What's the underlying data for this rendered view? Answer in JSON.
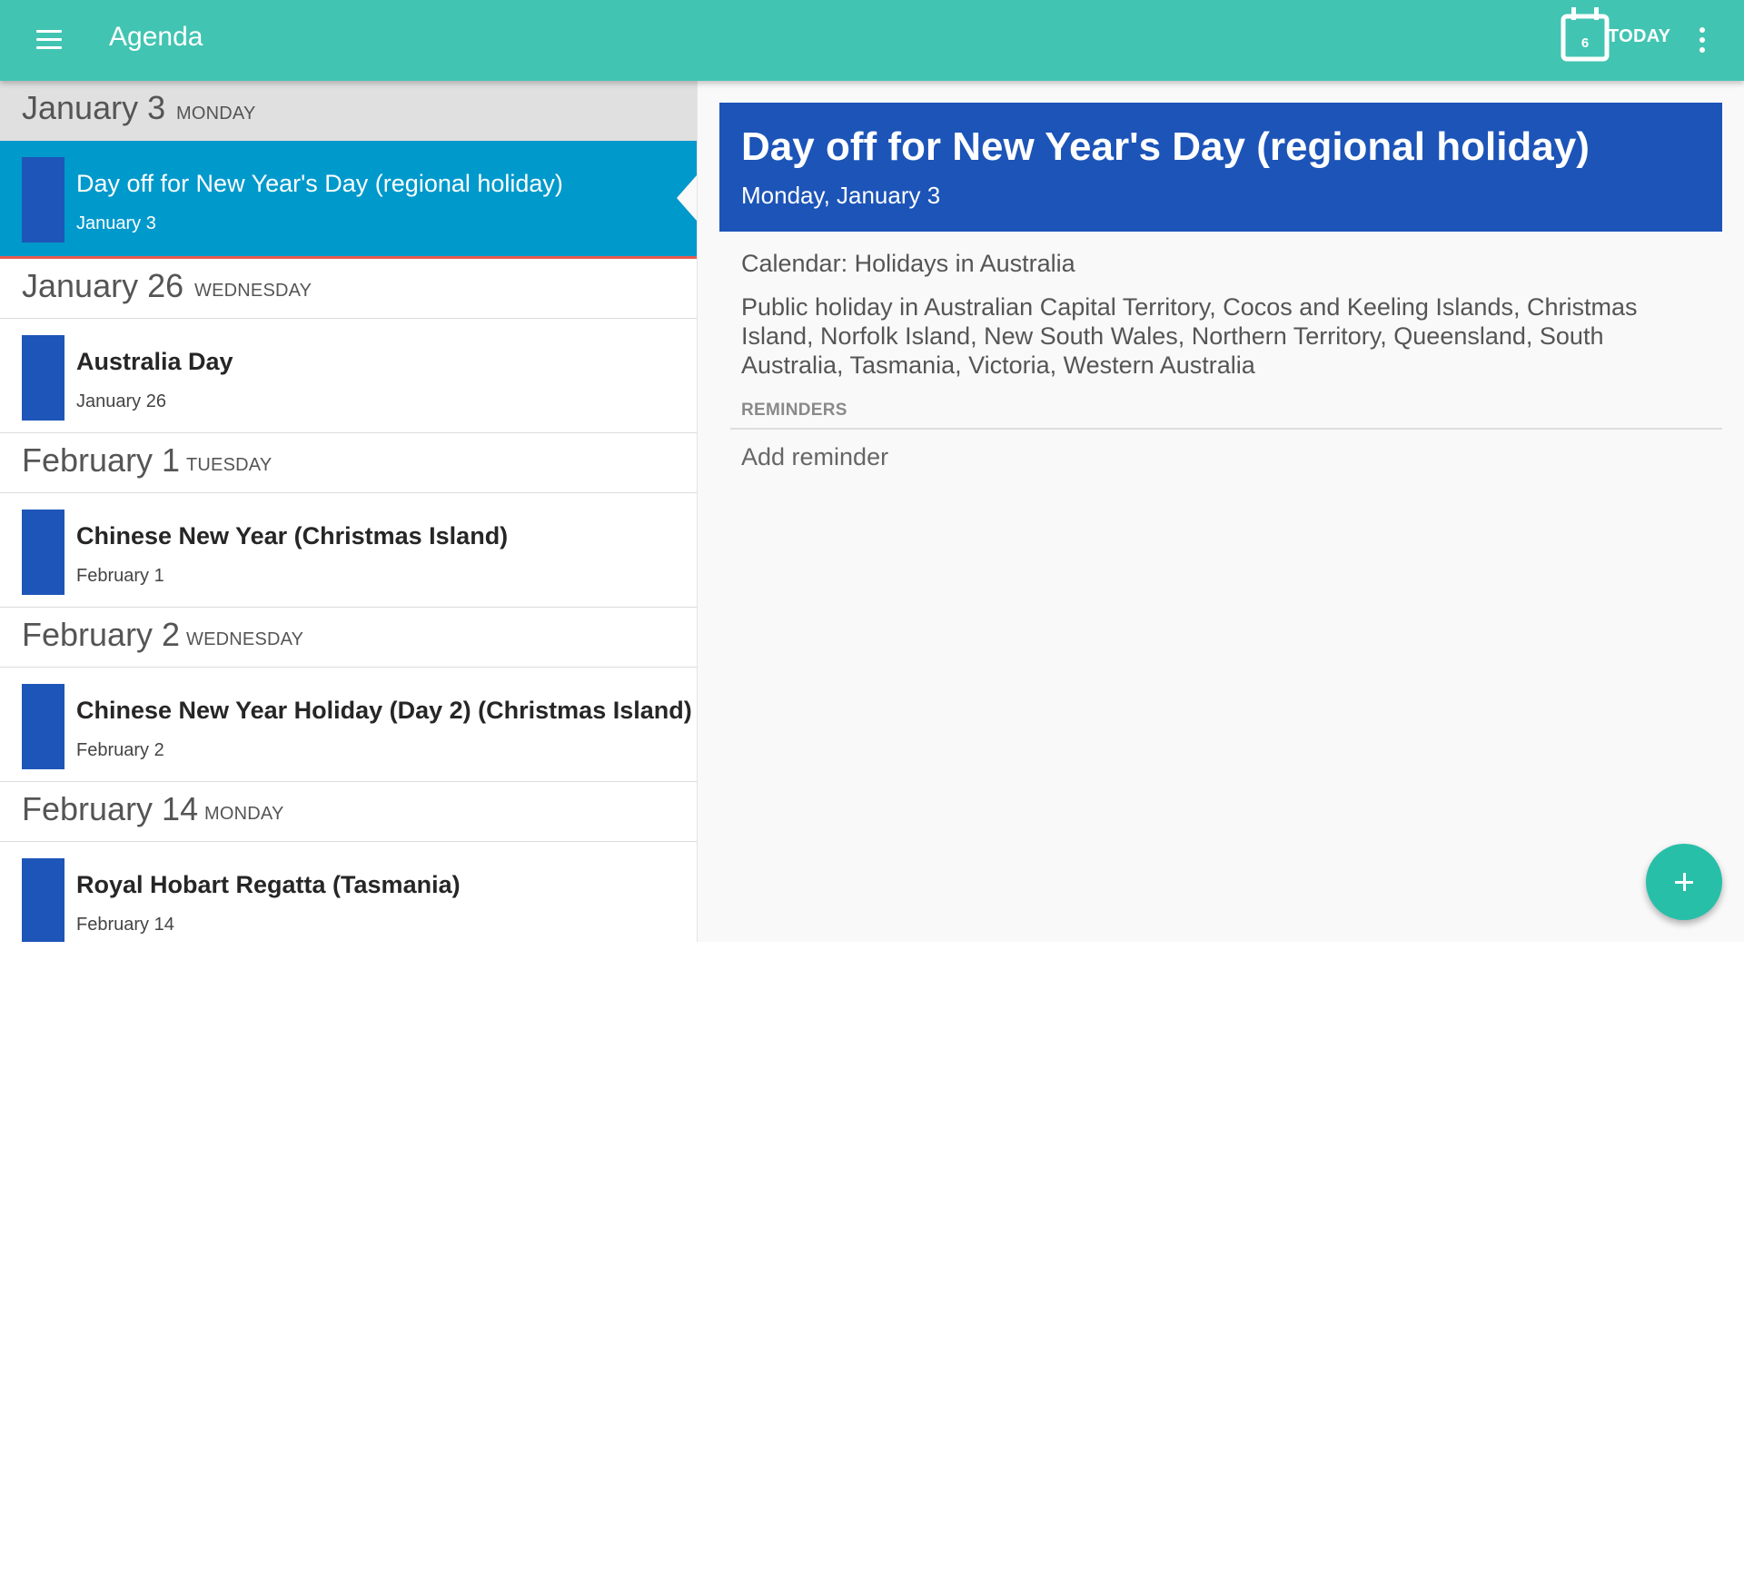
{
  "app_bar": {
    "title": "Agenda",
    "today_day_number": "6",
    "today_label": "TODAY",
    "accent_color": "#42c4b2"
  },
  "agenda": {
    "groups": [
      {
        "day": "January 3",
        "weekday": "MONDAY",
        "event": {
          "title": "Day off for New Year's Day (regional holiday)",
          "date": "January 3",
          "selected": true
        }
      },
      {
        "day": "January 26",
        "weekday": "WEDNESDAY",
        "event": {
          "title": "Australia Day",
          "date": "January 26",
          "selected": false
        }
      },
      {
        "day": "February 1",
        "weekday": "TUESDAY",
        "event": {
          "title": "Chinese New Year (Christmas Island)",
          "date": "February 1",
          "selected": false
        }
      },
      {
        "day": "February 2",
        "weekday": "WEDNESDAY",
        "event": {
          "title": "Chinese New Year Holiday (Day 2) (Christmas Island)",
          "date": "February 2",
          "selected": false
        }
      },
      {
        "day": "February 14",
        "weekday": "MONDAY",
        "event": {
          "title": "Royal Hobart Regatta (Tasmania)",
          "date": "February 14",
          "selected": false
        }
      }
    ],
    "event_color": "#1e55b8",
    "selected_color": "#0099cc"
  },
  "detail": {
    "title": "Day off for New Year's Day (regional holiday)",
    "date": "Monday, January 3",
    "calendar": "Calendar: Holidays in Australia",
    "description": "Public holiday in Australian Capital Territory, Cocos and Keeling Islands, Christmas Island, Norfolk Island, New South Wales, Northern Territory, Queensland, South Australia, Tasmania, Victoria, Western Australia",
    "reminders_label": "REMINDERS",
    "add_reminder_label": "Add reminder",
    "card_color": "#1c54b8"
  },
  "icons": {
    "menu": "menu-icon",
    "today": "calendar-today-icon",
    "overflow": "more-vert-icon",
    "fab": "plus-icon"
  }
}
